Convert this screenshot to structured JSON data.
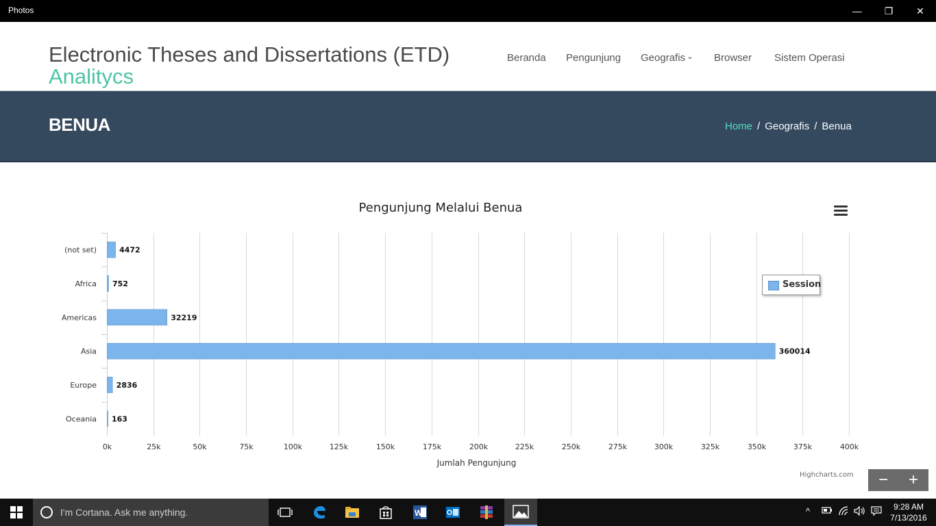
{
  "window": {
    "title": "Photos",
    "minimize_glyph": "—",
    "maximize_glyph": "❐",
    "close_glyph": "✕"
  },
  "site": {
    "title_line1": "Electronic Theses and Dissertations (ETD)",
    "title_line2": "Analitycs",
    "accent_color": "#4cc6a3"
  },
  "nav": {
    "items": [
      {
        "label": "Beranda"
      },
      {
        "label": "Pengunjung"
      },
      {
        "label": "Geografis",
        "has_dropdown": true
      },
      {
        "label": "Browser"
      },
      {
        "label": "Sistem Operasi"
      }
    ],
    "dropdown_glyph": "⌄"
  },
  "banner": {
    "title": "BENUA",
    "breadcrumb": [
      "Home",
      "Geografis",
      "Benua"
    ],
    "separator": "/",
    "background_color": "#34495e"
  },
  "chart_data": {
    "type": "bar",
    "orientation": "horizontal",
    "title": "Pengunjung Melalui Benua",
    "categories": [
      "(not set)",
      "Africa",
      "Americas",
      "Asia",
      "Europe",
      "Oceania"
    ],
    "series": [
      {
        "name": "Session",
        "values": [
          4472,
          752,
          32219,
          360014,
          2836,
          163
        ],
        "color": "#7cb5ec"
      }
    ],
    "data_labels": [
      "4472",
      "752",
      "32219",
      "360014",
      "2836",
      "163"
    ],
    "xlabel": "Jumlah Pengunjung",
    "ylabel": "",
    "xlim": [
      0,
      400000
    ],
    "tick_values": [
      0,
      25000,
      50000,
      75000,
      100000,
      125000,
      150000,
      175000,
      200000,
      225000,
      250000,
      275000,
      300000,
      325000,
      350000,
      375000,
      400000
    ],
    "tick_labels": [
      "0k",
      "25k",
      "50k",
      "75k",
      "100k",
      "125k",
      "150k",
      "175k",
      "200k",
      "225k",
      "250k",
      "275k",
      "300k",
      "325k",
      "350k",
      "375k",
      "400k"
    ],
    "grid": true,
    "legend": {
      "label": "Session",
      "placement": "right"
    },
    "credits": "Highcharts.com"
  },
  "viewer": {
    "zoom_out_glyph": "−",
    "zoom_in_glyph": "+"
  },
  "taskbar": {
    "cortana_placeholder": "I'm Cortana. Ask me anything.",
    "time": "9:28 AM",
    "date": "7/13/2016",
    "pinned": [
      "task-view-icon",
      "edge-icon",
      "file-explorer-icon",
      "store-icon",
      "word-icon",
      "outlook-icon",
      "winrar-icon",
      "photos-icon"
    ]
  }
}
